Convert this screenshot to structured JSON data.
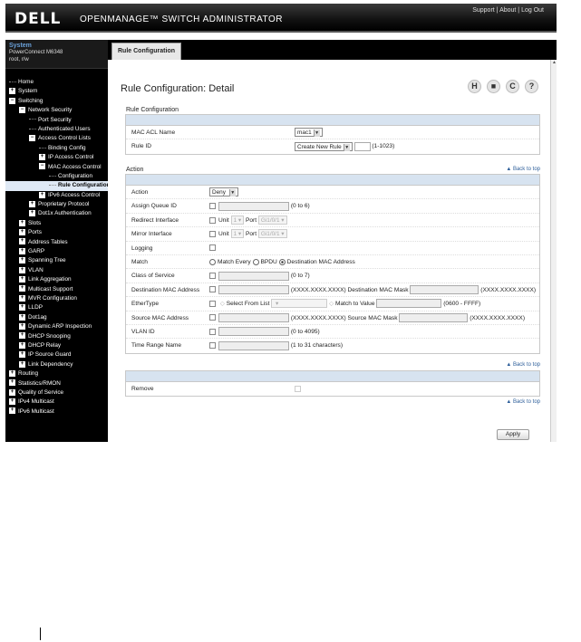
{
  "header": {
    "logo": "DELL",
    "app_title": "OPENMANAGE™ SWITCH ADMINISTRATOR",
    "links": [
      "Support",
      "About",
      "Log Out"
    ]
  },
  "system": {
    "title": "System",
    "model": "PowerConnect M6348",
    "user": "root, r/w"
  },
  "nav": [
    {
      "label": "Home",
      "level": 0,
      "icon": "leaf"
    },
    {
      "label": "System",
      "level": 0,
      "icon": "plus"
    },
    {
      "label": "Switching",
      "level": 0,
      "icon": "minus"
    },
    {
      "label": "Network Security",
      "level": 1,
      "icon": "minus"
    },
    {
      "label": "Port Security",
      "level": 2,
      "icon": "leaf"
    },
    {
      "label": "Authenticated Users",
      "level": 2,
      "icon": "leaf"
    },
    {
      "label": "Access Control Lists",
      "level": 2,
      "icon": "minus"
    },
    {
      "label": "Binding Config",
      "level": 3,
      "icon": "leaf"
    },
    {
      "label": "IP Access Control",
      "level": 3,
      "icon": "plus"
    },
    {
      "label": "MAC Access Control",
      "level": 3,
      "icon": "minus"
    },
    {
      "label": "Configuration",
      "level": 4,
      "icon": "leaf"
    },
    {
      "label": "Rule Configuration",
      "level": 4,
      "icon": "leaf",
      "selected": true
    },
    {
      "label": "IPv6 Access Control",
      "level": 3,
      "icon": "plus"
    },
    {
      "label": "Proprietary Protocol",
      "level": 2,
      "icon": "plus"
    },
    {
      "label": "Dot1x Authentication",
      "level": 2,
      "icon": "plus"
    },
    {
      "label": "Slots",
      "level": 1,
      "icon": "plus"
    },
    {
      "label": "Ports",
      "level": 1,
      "icon": "plus"
    },
    {
      "label": "Address Tables",
      "level": 1,
      "icon": "plus"
    },
    {
      "label": "GARP",
      "level": 1,
      "icon": "plus"
    },
    {
      "label": "Spanning Tree",
      "level": 1,
      "icon": "plus"
    },
    {
      "label": "VLAN",
      "level": 1,
      "icon": "plus"
    },
    {
      "label": "Link Aggregation",
      "level": 1,
      "icon": "plus"
    },
    {
      "label": "Multicast Support",
      "level": 1,
      "icon": "plus"
    },
    {
      "label": "MVR Configuration",
      "level": 1,
      "icon": "plus"
    },
    {
      "label": "LLDP",
      "level": 1,
      "icon": "plus"
    },
    {
      "label": "Dot1ag",
      "level": 1,
      "icon": "plus"
    },
    {
      "label": "Dynamic ARP Inspection",
      "level": 1,
      "icon": "plus"
    },
    {
      "label": "DHCP Snooping",
      "level": 1,
      "icon": "plus"
    },
    {
      "label": "DHCP Relay",
      "level": 1,
      "icon": "plus"
    },
    {
      "label": "IP Source Guard",
      "level": 1,
      "icon": "plus"
    },
    {
      "label": "Link Dependency",
      "level": 1,
      "icon": "plus"
    },
    {
      "label": "Routing",
      "level": 0,
      "icon": "plus"
    },
    {
      "label": "Statistics/RMON",
      "level": 0,
      "icon": "plus"
    },
    {
      "label": "Quality of Service",
      "level": 0,
      "icon": "plus"
    },
    {
      "label": "IPv4 Multicast",
      "level": 0,
      "icon": "plus"
    },
    {
      "label": "IPv6 Multicast",
      "level": 0,
      "icon": "plus"
    }
  ],
  "tab": "Rule Configuration",
  "page_title": "Rule Configuration: Detail",
  "section_rule": "Rule Configuration",
  "rule_config": {
    "mac_acl_name_label": "MAC ACL Name",
    "mac_acl_name_value": "mac1",
    "rule_id_label": "Rule ID",
    "rule_id_value": "Create New Rule",
    "rule_id_range": "(1-1023)"
  },
  "section_action": "Action",
  "back_to_top": "Back to top",
  "action": {
    "action_label": "Action",
    "action_value": "Deny",
    "assign_queue_label": "Assign Queue ID",
    "assign_queue_range": "(0 to 6)",
    "redirect_label": "Redirect Interface",
    "mirror_label": "Mirror Interface",
    "unit_label": "Unit",
    "unit_value": "1",
    "port_label": "Port",
    "port_value": "Gi1/0/1",
    "logging_label": "Logging",
    "match_label": "Match",
    "match_every": "Match Every",
    "bpdu": "BPDU",
    "dest_mac_opt": "Destination MAC Address",
    "cos_label": "Class of Service",
    "cos_range": "(0 to 7)",
    "dest_mac_label": "Destination MAC Address",
    "mac_format": "(XXXX.XXXX.XXXX)",
    "dest_mask_label": "Destination MAC Mask",
    "ethertype_label": "EtherType",
    "select_from_list": "Select From List",
    "match_to_value": "Match to Value",
    "ethertype_range": "(0600 - FFFF)",
    "src_mac_label": "Source MAC Address",
    "src_mask_label": "Source MAC Mask",
    "vlan_label": "VLAN ID",
    "vlan_range": "(0 to 4095)",
    "time_range_label": "Time Range Name",
    "time_range_hint": "(1 to 31 characters)"
  },
  "remove_label": "Remove",
  "apply_label": "Apply"
}
